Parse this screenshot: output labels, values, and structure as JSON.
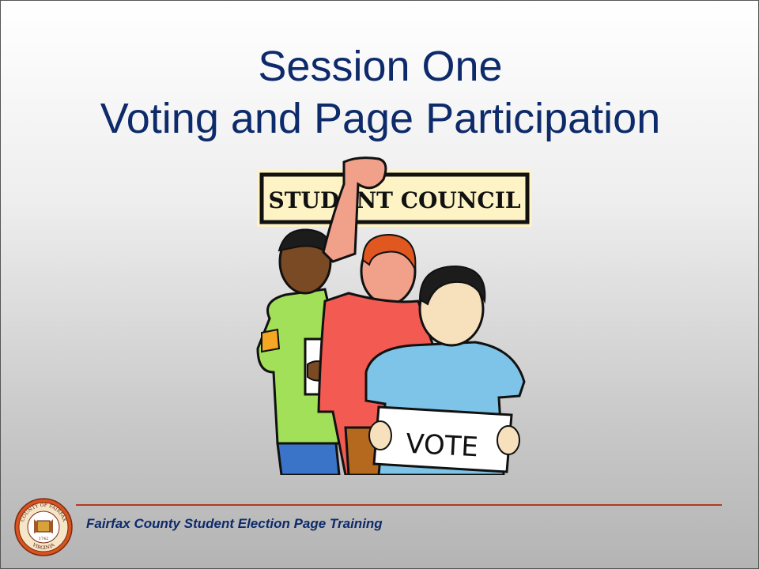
{
  "slide": {
    "title_line1": "Session One",
    "title_line2": "Voting and Page Participation",
    "footer_text": "Fairfax County Student Election Page Training"
  },
  "illustration": {
    "banner_text": "STUDENT COUNCIL",
    "sign_text": "VOTE"
  },
  "seal": {
    "text_top": "COUNTY OF FAIRFAX",
    "text_bottom": "VIRGINIA",
    "year": "1742"
  },
  "colors": {
    "title": "#0d2a6b",
    "divider": "#b5381c",
    "banner_bg": "#fdf3c4"
  }
}
